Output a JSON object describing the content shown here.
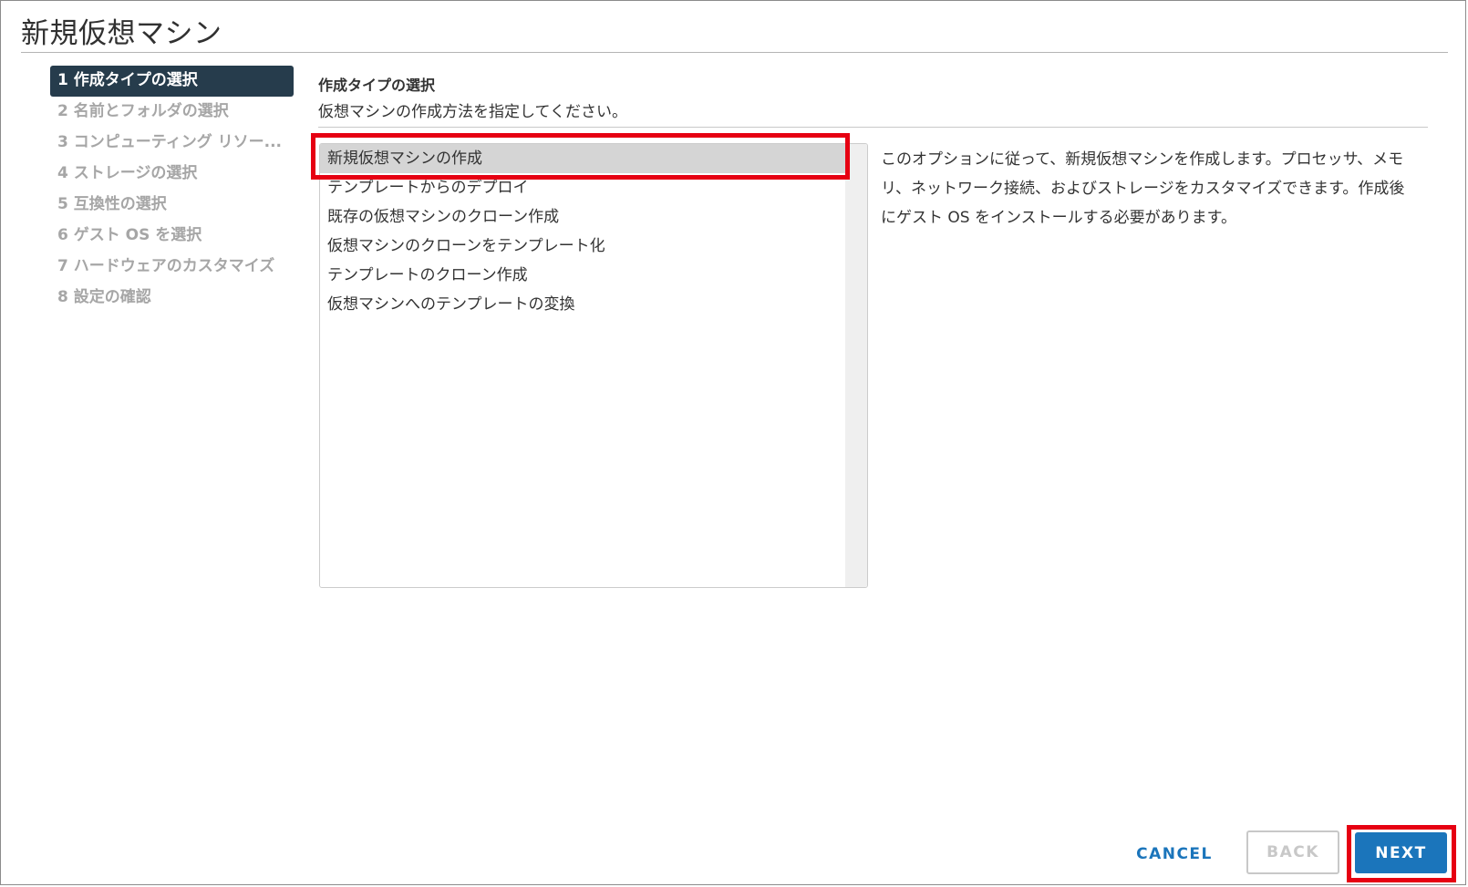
{
  "dialog": {
    "title": "新規仮想マシン"
  },
  "steps": [
    {
      "label": "1 作成タイプの選択",
      "active": true
    },
    {
      "label": "2 名前とフォルダの選択",
      "active": false
    },
    {
      "label": "3 コンピューティング リソー...",
      "active": false
    },
    {
      "label": "4 ストレージの選択",
      "active": false
    },
    {
      "label": "5 互換性の選択",
      "active": false
    },
    {
      "label": "6 ゲスト OS を選択",
      "active": false
    },
    {
      "label": "7 ハードウェアのカスタマイズ",
      "active": false
    },
    {
      "label": "8 設定の確認",
      "active": false
    }
  ],
  "main": {
    "section_title": "作成タイプの選択",
    "section_description": "仮想マシンの作成方法を指定してください。",
    "options": [
      {
        "label": "新規仮想マシンの作成",
        "selected": true
      },
      {
        "label": "テンプレートからのデプロイ",
        "selected": false
      },
      {
        "label": "既存の仮想マシンのクローン作成",
        "selected": false
      },
      {
        "label": "仮想マシンのクローンをテンプレート化",
        "selected": false
      },
      {
        "label": "テンプレートのクローン作成",
        "selected": false
      },
      {
        "label": "仮想マシンへのテンプレートの変換",
        "selected": false
      }
    ],
    "option_help": "このオプションに従って、新規仮想マシンを作成します。プロセッサ、メモリ、ネットワーク接続、およびストレージをカスタマイズできます。作成後にゲスト OS をインストールする必要があります。"
  },
  "footer": {
    "cancel_label": "CANCEL",
    "back_label": "BACK",
    "next_label": "NEXT"
  },
  "colors": {
    "accent": "#1b75bb",
    "active_step_bg": "#263c4c",
    "highlight": "#e60012",
    "selected_option_bg": "#d5d5d5"
  }
}
